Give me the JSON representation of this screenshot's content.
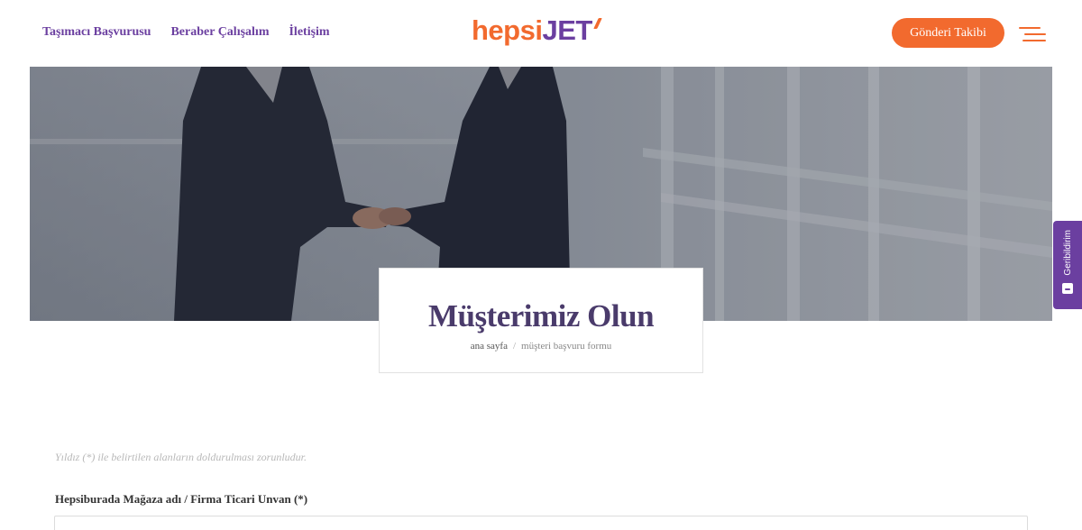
{
  "header": {
    "nav": [
      {
        "label": "Taşımacı Başvurusu"
      },
      {
        "label": "Beraber Çalışalım"
      },
      {
        "label": "İletişim"
      }
    ],
    "logo": {
      "part1": "hepsi",
      "part2": "JET"
    },
    "track_button": "Gönderi Takibi",
    "menu_icon": "hamburger-menu-icon"
  },
  "hero": {
    "image": "handshake-business-photo",
    "title": "Müşterimiz Olun",
    "breadcrumb": {
      "home": "ana sayfa",
      "separator": "/",
      "current": "müşteri başvuru formu"
    }
  },
  "feedback": {
    "label": "Geribildirim",
    "icon": "feedback-icon"
  },
  "form": {
    "required_note": "Yıldız (*) ile belirtilen alanların doldurulması zorunludur.",
    "fields": [
      {
        "label": "Hepsiburada Mağaza adı / Firma Ticari Unvan (*)",
        "value": ""
      }
    ]
  },
  "colors": {
    "brand_orange": "#f26a2e",
    "brand_purple": "#6b3fa0",
    "title_purple": "#4a3b6b"
  }
}
